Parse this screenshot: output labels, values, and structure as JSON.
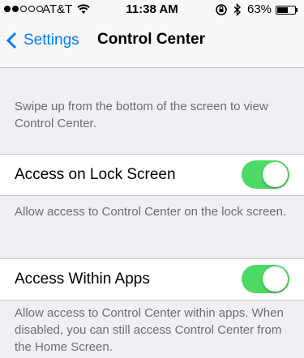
{
  "status_bar": {
    "carrier": "AT&T",
    "time": "11:38 AM",
    "battery_percent": "63%",
    "battery_level": 0.63,
    "signal_dots_filled": 2,
    "signal_dots_total": 5,
    "icons": [
      "wifi-icon",
      "rotation-lock-icon",
      "bluetooth-icon",
      "battery-icon"
    ]
  },
  "nav": {
    "back_label": "Settings",
    "title": "Control Center"
  },
  "intro": "Swipe up from the bottom of the screen to view Control Center.",
  "settings": [
    {
      "label": "Access on Lock Screen",
      "enabled": true,
      "description": "Allow access to Control Center on the lock screen."
    },
    {
      "label": "Access Within Apps",
      "enabled": true,
      "description": "Allow access to Control Center within apps. When disabled, you can still access Control Center from the Home Screen."
    }
  ],
  "colors": {
    "accent": "#007aff",
    "toggle_on": "#4cd964",
    "background": "#efeff4"
  }
}
